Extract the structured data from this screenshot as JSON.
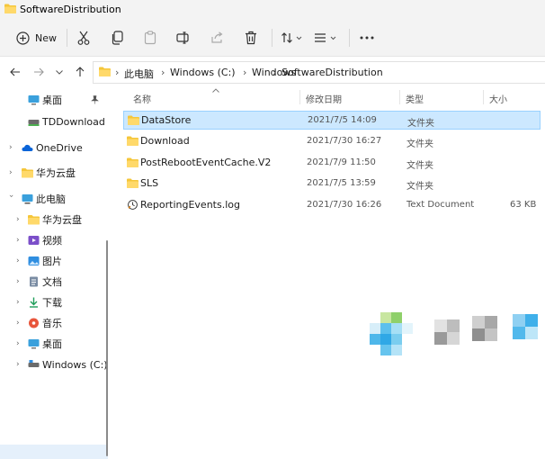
{
  "window": {
    "title": "SoftwareDistribution"
  },
  "toolbar": {
    "new_label": "New",
    "buttons": [
      "new-icon",
      "cut-icon",
      "copy-icon",
      "paste-icon",
      "rename-icon",
      "share-icon",
      "delete-icon",
      "sort-icon",
      "view-icon",
      "more-icon"
    ]
  },
  "address": {
    "back": "back-arrow-icon",
    "forward": "forward-arrow-icon",
    "recent": "chevron-down-icon",
    "up": "up-arrow-icon",
    "crumbs": [
      "此电脑",
      "Windows (C:)",
      "Windows",
      "SoftwareDistribution"
    ]
  },
  "sidebar": {
    "items": [
      {
        "label": "桌面",
        "icon": "desktop-icon"
      },
      {
        "label": "TDDownload (\\",
        "icon": "drive-icon"
      },
      {
        "label": "OneDrive",
        "icon": "cloud-icon"
      },
      {
        "label": "华为云盘",
        "icon": "folder-icon"
      },
      {
        "label": "此电脑",
        "icon": "computer-icon"
      },
      {
        "label": "华为云盘",
        "icon": "folder-icon"
      },
      {
        "label": "视频",
        "icon": "video-icon"
      },
      {
        "label": "图片",
        "icon": "pictures-icon"
      },
      {
        "label": "文档",
        "icon": "documents-icon"
      },
      {
        "label": "下载",
        "icon": "download-icon"
      },
      {
        "label": "音乐",
        "icon": "music-icon"
      },
      {
        "label": "桌面",
        "icon": "desktop-icon"
      },
      {
        "label": "Windows (C:)",
        "icon": "drive-icon"
      }
    ]
  },
  "columns": {
    "name": "名称",
    "date": "修改日期",
    "type": "类型",
    "size": "大小"
  },
  "files": [
    {
      "name": "DataStore",
      "date": "2021/7/5 14:09",
      "type": "文件夹",
      "size": "",
      "icon": "folder-icon"
    },
    {
      "name": "Download",
      "date": "2021/7/30 16:27",
      "type": "文件夹",
      "size": "",
      "icon": "folder-icon"
    },
    {
      "name": "PostRebootEventCache.V2",
      "date": "2021/7/9 11:50",
      "type": "文件夹",
      "size": "",
      "icon": "folder-icon"
    },
    {
      "name": "SLS",
      "date": "2021/7/5 13:59",
      "type": "文件夹",
      "size": "",
      "icon": "folder-icon"
    },
    {
      "name": "ReportingEvents.log",
      "date": "2021/7/30 16:26",
      "type": "Text Document",
      "size": "63 KB",
      "icon": "log-file-icon"
    }
  ],
  "colors": {
    "accent": "#0067c0",
    "folder": "#f5c63a",
    "selected_bg": "#cce8ff",
    "selected_border": "#99d1ff"
  }
}
